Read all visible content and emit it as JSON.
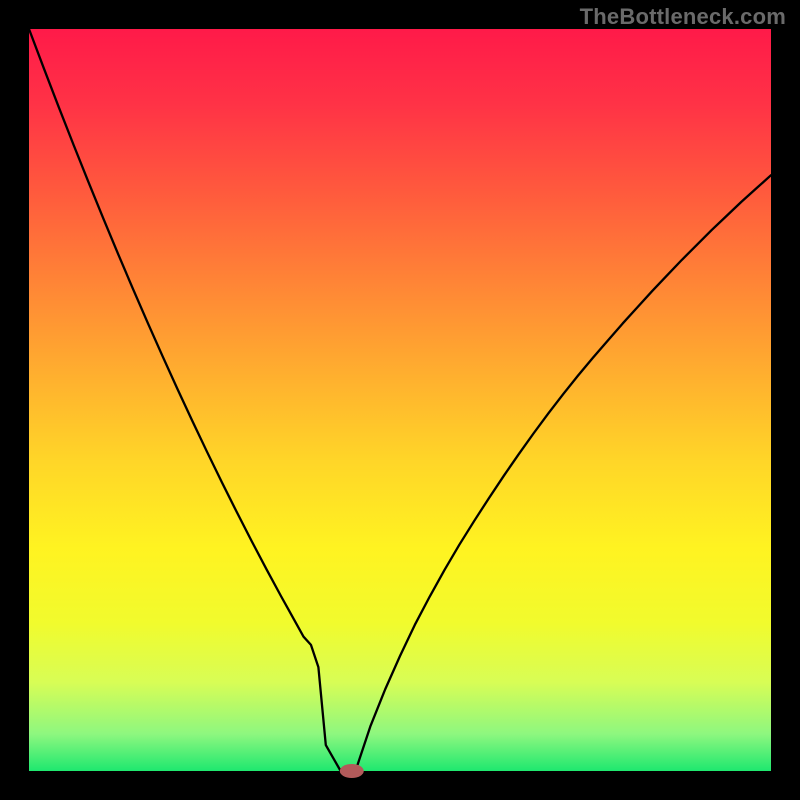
{
  "watermark": "TheBottleneck.com",
  "chart_data": {
    "type": "line",
    "title": "",
    "xlabel": "",
    "ylabel": "",
    "xlim": [
      0,
      100
    ],
    "ylim": [
      0,
      100
    ],
    "grid": false,
    "legend": false,
    "annotations": [],
    "x": [
      0,
      2,
      4,
      6,
      8,
      10,
      12,
      14,
      16,
      18,
      20,
      22,
      24,
      26,
      28,
      30,
      32,
      34,
      35,
      36,
      37,
      38,
      39,
      40,
      42,
      44,
      46,
      48,
      50,
      52,
      54,
      56,
      58,
      60,
      62,
      64,
      66,
      68,
      70,
      72,
      74,
      76,
      78,
      80,
      82,
      84,
      86,
      88,
      90,
      92,
      94,
      96,
      98,
      100
    ],
    "values": [
      100,
      94.7,
      89.5,
      84.4,
      79.4,
      74.5,
      69.7,
      65.0,
      60.4,
      55.9,
      51.5,
      47.2,
      43.0,
      38.9,
      34.9,
      31.0,
      27.2,
      23.5,
      21.7,
      19.9,
      18.1,
      17.0,
      14.0,
      3.5,
      0.0,
      0.0,
      6.0,
      11.0,
      15.5,
      19.7,
      23.5,
      27.1,
      30.5,
      33.7,
      36.8,
      39.8,
      42.7,
      45.5,
      48.2,
      50.8,
      53.3,
      55.7,
      58.0,
      60.3,
      62.5,
      64.7,
      66.8,
      68.9,
      70.9,
      72.9,
      74.8,
      76.7,
      78.5,
      80.3
    ],
    "marker": {
      "x": 43.5,
      "y": 0.0,
      "color": "#b25a5a",
      "rx": 12,
      "ry": 7
    },
    "background_gradient": {
      "stops": [
        {
          "offset": 0.0,
          "color": "#ff1a49"
        },
        {
          "offset": 0.1,
          "color": "#ff3246"
        },
        {
          "offset": 0.22,
          "color": "#ff5a3d"
        },
        {
          "offset": 0.34,
          "color": "#ff8436"
        },
        {
          "offset": 0.46,
          "color": "#ffad2f"
        },
        {
          "offset": 0.58,
          "color": "#ffd528"
        },
        {
          "offset": 0.7,
          "color": "#fff321"
        },
        {
          "offset": 0.8,
          "color": "#f1fb2d"
        },
        {
          "offset": 0.88,
          "color": "#d8fd55"
        },
        {
          "offset": 0.95,
          "color": "#8ef77f"
        },
        {
          "offset": 1.0,
          "color": "#1ee86f"
        }
      ]
    },
    "frame_color": "#000000",
    "frame_width": 28,
    "curve_color": "#000000",
    "curve_width": 2.3
  }
}
